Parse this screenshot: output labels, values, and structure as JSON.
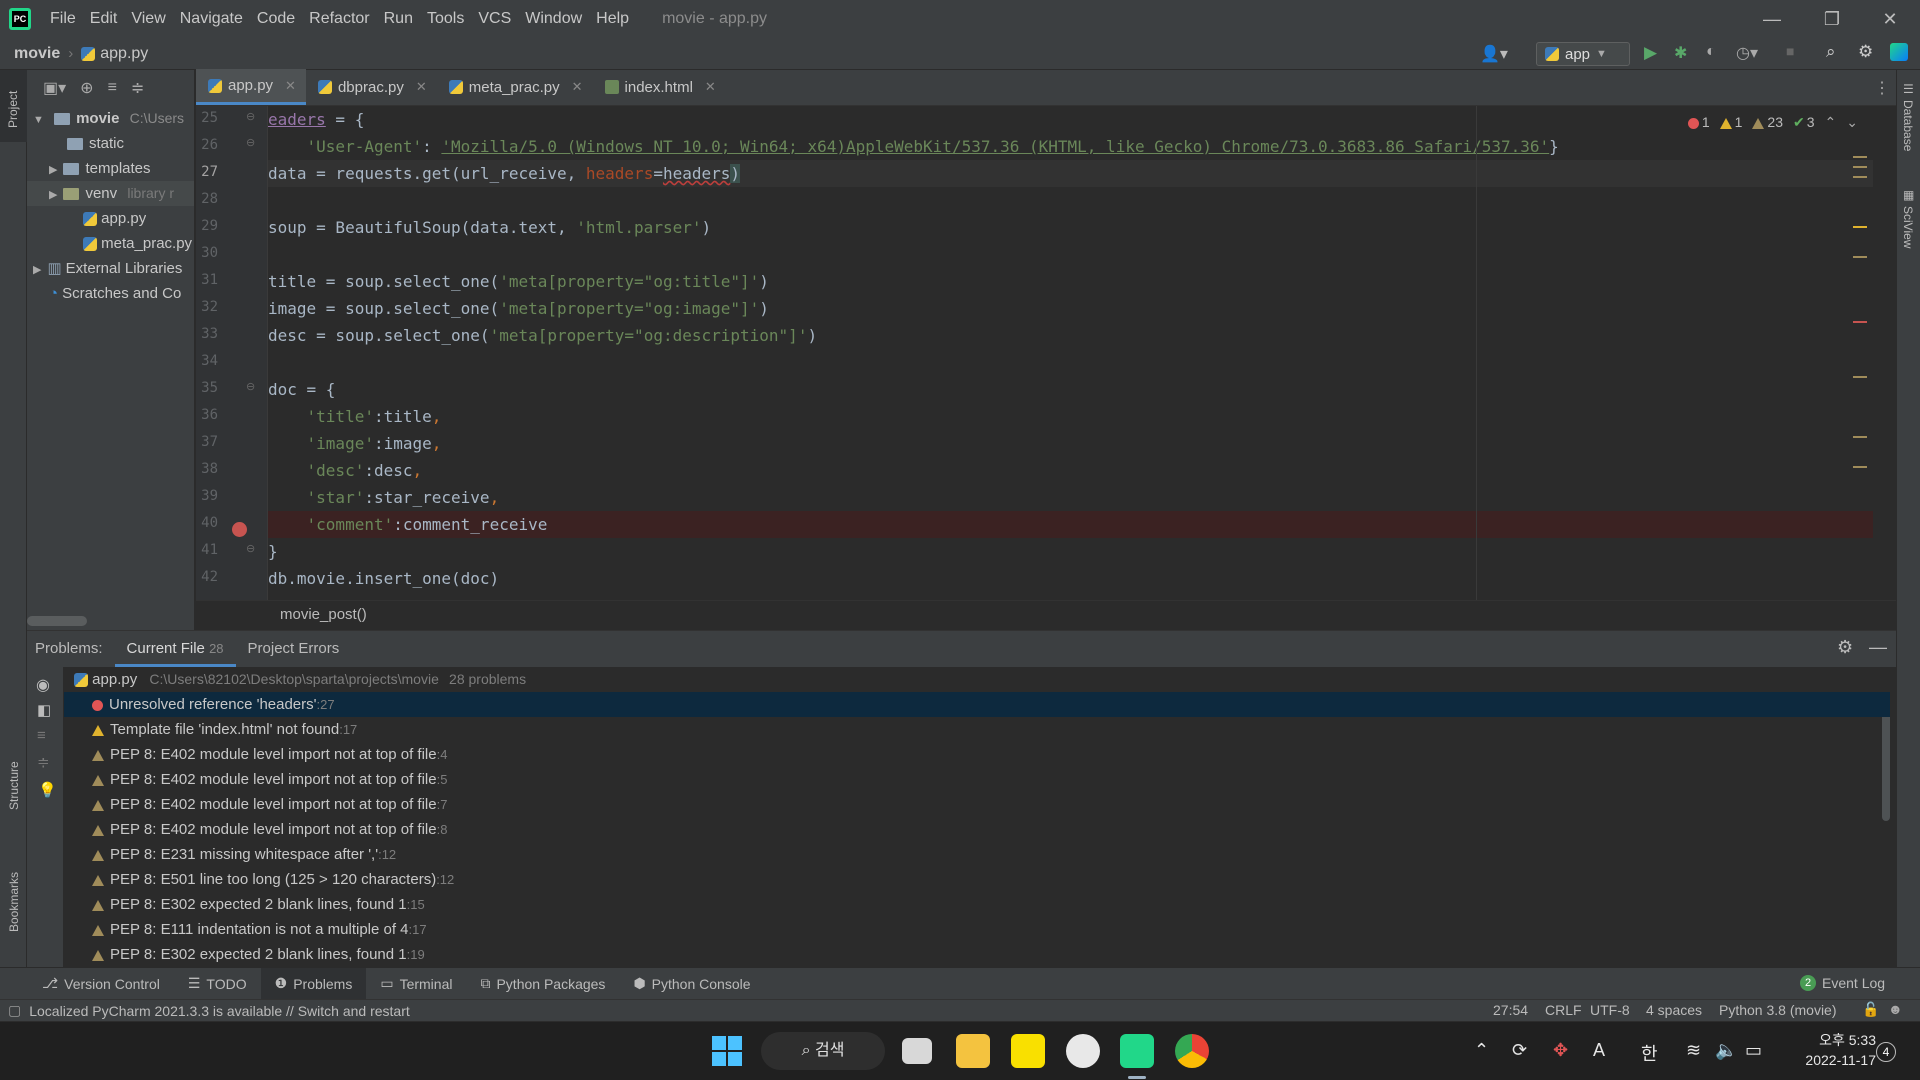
{
  "window": {
    "menu": [
      "File",
      "Edit",
      "View",
      "Navigate",
      "Code",
      "Refactor",
      "Run",
      "Tools",
      "VCS",
      "Window",
      "Help"
    ],
    "title": "movie - app.py",
    "controls": {
      "minimize": "—",
      "restore": "❐",
      "close": "✕"
    }
  },
  "navbar": {
    "project": "movie",
    "file": "app.py",
    "run_config": "app"
  },
  "side_strips": {
    "left_top": "Project",
    "left_structure": "Structure",
    "left_bookmarks": "Bookmarks",
    "right_database": "Database",
    "right_sciview": "SciView"
  },
  "project_tree": [
    {
      "label": "movie",
      "hint": "C:\\Users",
      "bold": true
    },
    {
      "label": "static"
    },
    {
      "label": "templates"
    },
    {
      "label": "venv",
      "hint": "library r"
    },
    {
      "label": "app.py"
    },
    {
      "label": "meta_prac.py"
    },
    {
      "label": "External Libraries"
    },
    {
      "label": "Scratches and Co"
    }
  ],
  "editor_tabs": [
    {
      "label": "app.py",
      "active": true
    },
    {
      "label": "dbprac.py"
    },
    {
      "label": "meta_prac.py"
    },
    {
      "label": "index.html"
    }
  ],
  "inspections": {
    "errors": "1",
    "warnings": "1",
    "weak_warnings": "23",
    "typos": "3"
  },
  "code_lines": {
    "n25": "25",
    "n26": "26",
    "n27": "27",
    "n28": "28",
    "n29": "29",
    "n30": "30",
    "n31": "31",
    "n32": "32",
    "n33": "33",
    "n34": "34",
    "n35": "35",
    "n36": "36",
    "n37": "37",
    "n38": "38",
    "n39": "39",
    "n40": "40",
    "n41": "41",
    "n42": "42",
    "l25_a": "eaders",
    "l25_b": " = {",
    "l26_key": "'User-Agent'",
    "l26_val": "'Mozilla/5.0 (Windows NT 10.0; Win64; x64)AppleWebKit/537.36 (KHTML, like Gecko) Chrome/73.0.3683.86 Safari/537.36'",
    "l26_end": "}",
    "l27_a": "data = requests.get(url_receive, ",
    "l27_param": "headers",
    "l27_eq": "=",
    "l27_ref": "headers",
    "l27_end": ")",
    "l29_a": "soup = BeautifulSoup(data.text, ",
    "l29_s": "'html.parser'",
    "l29_b": ")",
    "l31_a": "title = soup.select_one(",
    "l31_s": "'meta[property=\"og:title\"]'",
    "l31_b": ")",
    "l32_a": "image = soup.select_one(",
    "l32_s": "'meta[property=\"og:image\"]'",
    "l32_b": ")",
    "l33_a": "desc = soup.select_one(",
    "l33_s": "'meta[property=\"og:description\"]'",
    "l33_b": ")",
    "l35": "doc = {",
    "l36_s": "'title'",
    "l36_b": ":title",
    "l37_s": "'image'",
    "l37_b": ":image",
    "l38_s": "'desc'",
    "l38_b": ":desc",
    "l39_s": "'star'",
    "l39_b": ":star_receive",
    "l40_s": "'comment'",
    "l40_b": ":comment_receive",
    "comma": ",",
    "l41": "}",
    "l42": "db.movie.insert_one(doc)"
  },
  "editor_breadcrumb": "movie_post()",
  "problems": {
    "header": "Problems:",
    "tabs": {
      "current_file": "Current File",
      "current_count": "28",
      "project_errors": "Project Errors"
    },
    "file": {
      "name": "app.py",
      "path": "C:\\Users\\82102\\Desktop\\sparta\\projects\\movie",
      "count": "28 problems"
    },
    "items": [
      {
        "text": "Unresolved reference 'headers'",
        "line": ":27",
        "severity": "error"
      },
      {
        "text": "Template file 'index.html' not found",
        "line": ":17",
        "severity": "warning"
      },
      {
        "text": "PEP 8: E402 module level import not at top of file",
        "line": ":4",
        "severity": "weak"
      },
      {
        "text": "PEP 8: E402 module level import not at top of file",
        "line": ":5",
        "severity": "weak"
      },
      {
        "text": "PEP 8: E402 module level import not at top of file",
        "line": ":7",
        "severity": "weak"
      },
      {
        "text": "PEP 8: E402 module level import not at top of file",
        "line": ":8",
        "severity": "weak"
      },
      {
        "text": "PEP 8: E231 missing whitespace after ','",
        "line": ":12",
        "severity": "weak"
      },
      {
        "text": "PEP 8: E501 line too long (125 > 120 characters)",
        "line": ":12",
        "severity": "weak"
      },
      {
        "text": "PEP 8: E302 expected 2 blank lines, found 1",
        "line": ":15",
        "severity": "weak"
      },
      {
        "text": "PEP 8: E111 indentation is not a multiple of 4",
        "line": ":17",
        "severity": "weak"
      },
      {
        "text": "PEP 8: E302 expected 2 blank lines, found 1",
        "line": ":19",
        "severity": "weak"
      }
    ]
  },
  "bottom_tools": [
    {
      "label": "Version Control"
    },
    {
      "label": "TODO"
    },
    {
      "label": "Problems",
      "active": true
    },
    {
      "label": "Terminal"
    },
    {
      "label": "Python Packages"
    },
    {
      "label": "Python Console"
    }
  ],
  "event_log": {
    "count": "2",
    "label": "Event Log"
  },
  "status": {
    "message": "Localized PyCharm 2021.3.3 is available // Switch and restart",
    "position": "27:54",
    "line_sep": "CRLF",
    "encoding": "UTF-8",
    "indent": "4 spaces",
    "interpreter": "Python 3.8 (movie)"
  },
  "taskbar": {
    "search": "검색",
    "ime_a": "A",
    "ime_han": "한",
    "time": "오후 5:33",
    "date": "2022-11-17",
    "notifications": "4"
  },
  "colors": {
    "accent": "#4a88c7",
    "error": "#c75450",
    "warning": "#e0b32e",
    "string": "#6a8759",
    "keyword": "#cc7832"
  }
}
